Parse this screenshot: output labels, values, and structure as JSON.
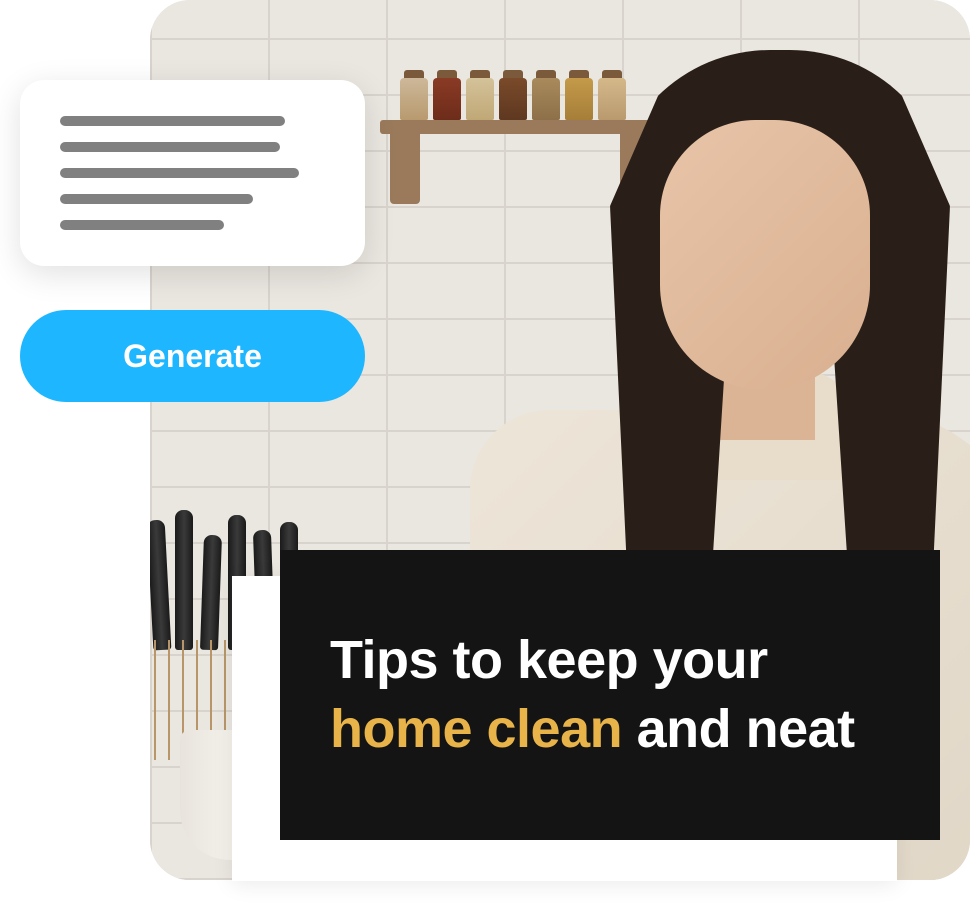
{
  "button": {
    "generate_label": "Generate"
  },
  "caption": {
    "part1": "Tips to keep your ",
    "highlight": "home clean",
    "part2": " and neat"
  },
  "colors": {
    "accent_blue": "#1eb7ff",
    "highlight_gold": "#e8b44a",
    "panel_dark": "#141414"
  },
  "image": {
    "description": "Woman in cream sweater standing in a kitchen with white brick wall, wooden spice shelf, knife block, and a mug"
  }
}
